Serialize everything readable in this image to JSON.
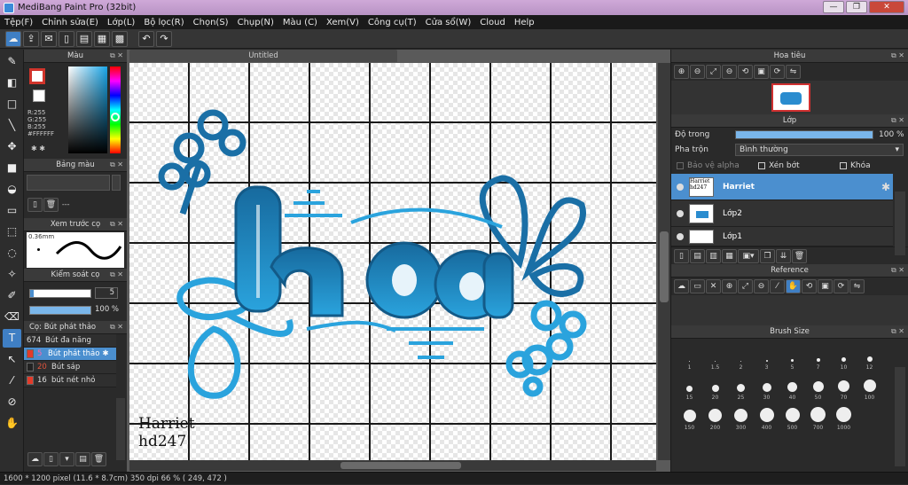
{
  "window": {
    "title": "MediBang Paint Pro (32bit)",
    "minimize": "—",
    "restore": "❐",
    "close": "✕"
  },
  "menu": [
    "Tệp(F)",
    "Chỉnh sửa(E)",
    "Lớp(L)",
    "Bộ lọc(R)",
    "Chọn(S)",
    "Chụp(N)",
    "Màu (C)",
    "Xem(V)",
    "Công cụ(T)",
    "Cửa sổ(W)",
    "Cloud",
    "Help"
  ],
  "left": {
    "color_panel": {
      "title": "Màu",
      "r": "R:255",
      "g": "G:255",
      "b": "B:255",
      "hex": "#FFFFFF"
    },
    "palette_panel": {
      "title": "Bảng màu",
      "dash": "---"
    },
    "preview_panel": {
      "title": "Xem trước cọ",
      "size": "0.36mm"
    },
    "control_panel": {
      "title": "Kiểm soát cọ",
      "size_value": "5",
      "opacity_value": "100 %"
    },
    "brush_panel": {
      "title": "Cọ: Bút phát thảo",
      "items": [
        {
          "num": "674",
          "name": "Bút đa năng",
          "color": "#222222"
        },
        {
          "num": "5",
          "name": "Bút phát thảo",
          "color": "#222222"
        },
        {
          "num": "20",
          "name": "Bút sáp",
          "color": "#222222"
        },
        {
          "num": "16",
          "name": "bút nét nhỏ",
          "color": "#e33b2a"
        }
      ]
    }
  },
  "canvas": {
    "tab": "Untitled",
    "signature_line1": "Harriet",
    "signature_line2": "hd247",
    "art_text": "hòa"
  },
  "right": {
    "navigator": {
      "title": "Hoa tiêu"
    },
    "layer": {
      "title": "Lớp",
      "opacity_label": "Độ trong",
      "opacity_value": "100 %",
      "opacity_fraction": 1.0,
      "blend_label": "Pha trộn",
      "blend_value": "Bình thường",
      "protect_alpha": "Bảo vệ alpha",
      "clipping": "Xén bớt",
      "lock": "Khóa",
      "layers": [
        {
          "name": "Harriet",
          "thumb": "Harriet hd247"
        },
        {
          "name": "Lớp2",
          "thumb": ""
        },
        {
          "name": "Lớp1",
          "thumb": ""
        }
      ]
    },
    "reference": {
      "title": "Reference"
    },
    "brush_size": {
      "title": "Brush Size",
      "sizes": [
        "1",
        "1.5",
        "2",
        "3",
        "5",
        "7",
        "10",
        "12",
        "15",
        "20",
        "25",
        "30",
        "40",
        "50",
        "70",
        "100",
        "150",
        "200",
        "300",
        "400",
        "500",
        "700",
        "1000"
      ]
    }
  },
  "status": {
    "text": "1600 * 1200 pixel  (11.6 * 8.7cm)  350 dpi  66 %  ( 249, 472 )"
  },
  "colors": {
    "accent": "#4b8fcf",
    "art_dark": "#1a6fa6",
    "art_light": "#2aa3dd"
  }
}
